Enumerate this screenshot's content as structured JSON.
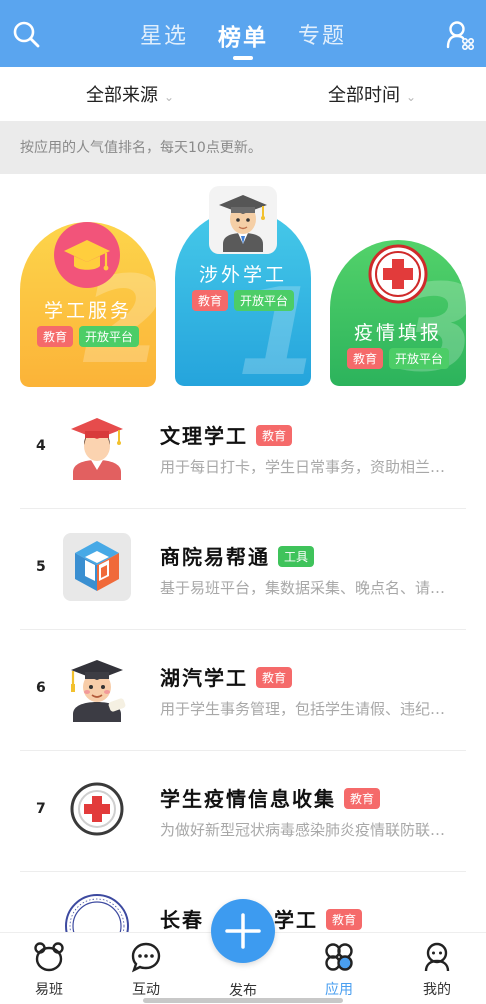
{
  "header": {
    "tabs": [
      {
        "label": "星选",
        "active": false
      },
      {
        "label": "榜单",
        "active": true
      },
      {
        "label": "专题",
        "active": false
      }
    ]
  },
  "filters": {
    "source": "全部来源",
    "time": "全部时间"
  },
  "info_text": "按应用的人气值排名，每天10点更新。",
  "podium": [
    {
      "rank": "2",
      "name": "学工服务",
      "tags": [
        "教育",
        "开放平台"
      ]
    },
    {
      "rank": "1",
      "name": "涉外学工",
      "tags": [
        "教育",
        "开放平台"
      ]
    },
    {
      "rank": "3",
      "name": "疫情填报",
      "tags": [
        "教育",
        "开放平台"
      ]
    }
  ],
  "list": [
    {
      "rank": "4",
      "title": "文理学工",
      "tag": "教育",
      "desc": "用于每日打卡，学生日常事务，资助相兰…"
    },
    {
      "rank": "5",
      "title": "商院易帮通",
      "tag": "工具",
      "desc": "基于易班平台，集数据采集、晚点名、请…"
    },
    {
      "rank": "6",
      "title": "湖汽学工",
      "tag": "教育",
      "desc": "用于学生事务管理，包括学生请假、违纪…"
    },
    {
      "rank": "7",
      "title": "学生疫情信息收集",
      "tag": "教育",
      "desc": "为做好新型冠状病毒感染肺炎疫情联防联…"
    },
    {
      "rank": "",
      "title": "长春",
      "title_tail": "学工",
      "tag": "教育",
      "desc": ""
    }
  ],
  "bottom_nav": [
    {
      "label": "易班",
      "active": false
    },
    {
      "label": "互动",
      "active": false
    },
    {
      "label": "发布",
      "active": false
    },
    {
      "label": "应用",
      "active": true
    },
    {
      "label": "我的",
      "active": false
    }
  ],
  "colors": {
    "primary": "#5aa5ef",
    "fab": "#3d9bf0",
    "tag_edu": "#f56a6a",
    "tag_open": "#4ccd67"
  }
}
